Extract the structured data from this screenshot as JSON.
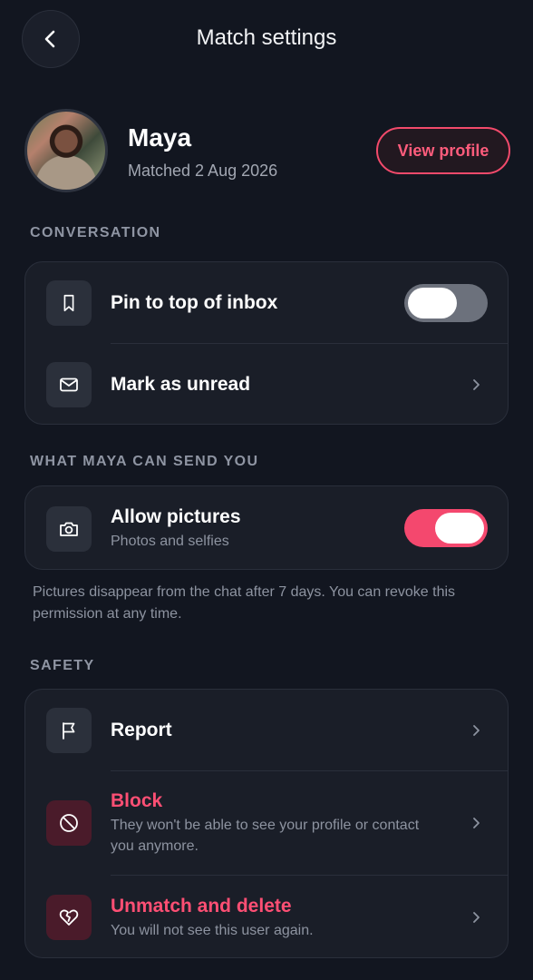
{
  "header": {
    "title": "Match settings",
    "back_icon": "chevron-left-icon"
  },
  "profile": {
    "name": "Maya",
    "matched": "Matched 2 Aug 2026",
    "view_profile_label": "View profile"
  },
  "conversation": {
    "label": "CONVERSATION",
    "pin": {
      "title": "Pin to top of inbox",
      "icon": "bookmark-icon",
      "enabled": false
    },
    "unread": {
      "title": "Mark as unread",
      "icon": "mail-icon"
    }
  },
  "pictures": {
    "label": "WHAT MAYA CAN SEND YOU",
    "allow": {
      "title": "Allow pictures",
      "subtitle": "Photos and selfies",
      "icon": "camera-icon",
      "enabled": true
    },
    "note": "Pictures disappear from the chat after 7 days. You can revoke this permission at any time."
  },
  "safety": {
    "label": "SAFETY",
    "report": {
      "title": "Report",
      "icon": "flag-icon"
    },
    "block": {
      "title": "Block",
      "subtitle": "They won't be able to see your profile or contact you anymore.",
      "icon": "block-icon"
    },
    "unmatch": {
      "title": "Unmatch and delete",
      "subtitle": "You will not see this user again.",
      "icon": "broken-heart-icon"
    }
  },
  "colors": {
    "background": "#121620",
    "card": "#1a1e28",
    "accent": "#f4486e",
    "muted_text": "#8d93a0"
  }
}
